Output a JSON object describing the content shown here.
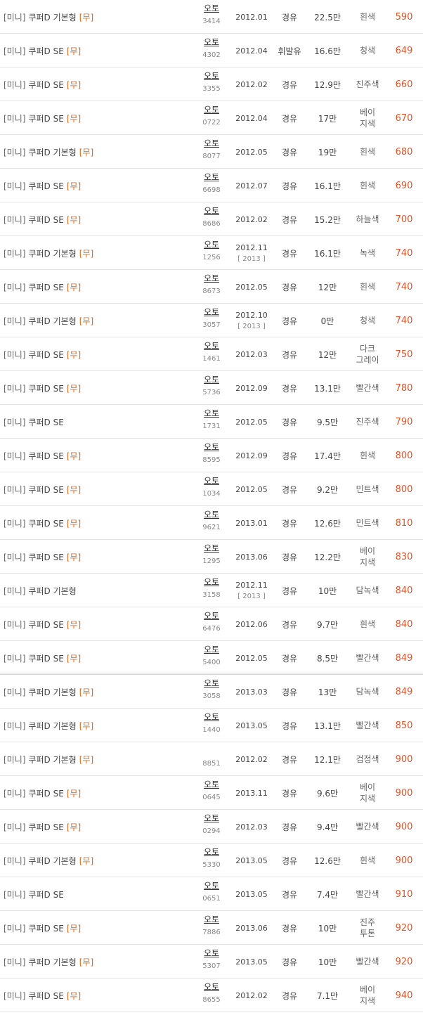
{
  "listings": [
    {
      "category": "[미니]",
      "model": "쿠퍼D 기본형",
      "tag": "[무]",
      "trans": "오토",
      "stock": "3414",
      "year": "2012.01",
      "year2": "",
      "fuel": "경유",
      "km": "22.5만",
      "color": "흰색",
      "price": "590"
    },
    {
      "category": "[미니]",
      "model": "쿠퍼D SE",
      "tag": "[무]",
      "trans": "오토",
      "stock": "4302",
      "year": "2012.04",
      "year2": "",
      "fuel": "휘발유",
      "km": "16.6만",
      "color": "청색",
      "price": "649"
    },
    {
      "category": "[미니]",
      "model": "쿠퍼D SE",
      "tag": "[무]",
      "trans": "오토",
      "stock": "3355",
      "year": "2012.02",
      "year2": "",
      "fuel": "경유",
      "km": "12.9만",
      "color": "진주색",
      "price": "660"
    },
    {
      "category": "[미니]",
      "model": "쿠퍼D SE",
      "tag": "[무]",
      "trans": "오토",
      "stock": "0722",
      "year": "2012.04",
      "year2": "",
      "fuel": "경유",
      "km": "17만",
      "color": "베이\n지색",
      "price": "670"
    },
    {
      "category": "[미니]",
      "model": "쿠퍼D 기본형",
      "tag": "[무]",
      "trans": "오토",
      "stock": "8077",
      "year": "2012.05",
      "year2": "",
      "fuel": "경유",
      "km": "19만",
      "color": "흰색",
      "price": "680"
    },
    {
      "category": "[미니]",
      "model": "쿠퍼D SE",
      "tag": "[무]",
      "trans": "오토",
      "stock": "6698",
      "year": "2012.07",
      "year2": "",
      "fuel": "경유",
      "km": "16.1만",
      "color": "흰색",
      "price": "690"
    },
    {
      "category": "[미니]",
      "model": "쿠퍼D SE",
      "tag": "[무]",
      "trans": "오토",
      "stock": "8686",
      "year": "2012.02",
      "year2": "",
      "fuel": "경유",
      "km": "15.2만",
      "color": "하늘색",
      "price": "700"
    },
    {
      "category": "[미니]",
      "model": "쿠퍼D 기본형",
      "tag": "[무]",
      "trans": "오토",
      "stock": "1256",
      "year": "2012.11",
      "year2": "[ 2013 ]",
      "fuel": "경유",
      "km": "16.1만",
      "color": "녹색",
      "price": "740"
    },
    {
      "category": "[미니]",
      "model": "쿠퍼D SE",
      "tag": "[무]",
      "trans": "오토",
      "stock": "8673",
      "year": "2012.05",
      "year2": "",
      "fuel": "경유",
      "km": "12만",
      "color": "흰색",
      "price": "740"
    },
    {
      "category": "[미니]",
      "model": "쿠퍼D 기본형",
      "tag": "[무]",
      "trans": "오토",
      "stock": "3057",
      "year": "2012.10",
      "year2": "[ 2013 ]",
      "fuel": "경유",
      "km": "0만",
      "color": "청색",
      "price": "740"
    },
    {
      "category": "[미니]",
      "model": "쿠퍼D SE",
      "tag": "[무]",
      "trans": "오토",
      "stock": "1461",
      "year": "2012.03",
      "year2": "",
      "fuel": "경유",
      "km": "12만",
      "color": "다크\n그레이",
      "price": "750"
    },
    {
      "category": "[미니]",
      "model": "쿠퍼D SE",
      "tag": "[무]",
      "trans": "오토",
      "stock": "5736",
      "year": "2012.09",
      "year2": "",
      "fuel": "경유",
      "km": "13.1만",
      "color": "빨간색",
      "price": "780"
    },
    {
      "category": "[미니]",
      "model": "쿠퍼D SE",
      "tag": "",
      "trans": "오토",
      "stock": "1731",
      "year": "2012.05",
      "year2": "",
      "fuel": "경유",
      "km": "9.5만",
      "color": "진주색",
      "price": "790"
    },
    {
      "category": "[미니]",
      "model": "쿠퍼D SE",
      "tag": "[무]",
      "trans": "오토",
      "stock": "8595",
      "year": "2012.09",
      "year2": "",
      "fuel": "경유",
      "km": "17.4만",
      "color": "흰색",
      "price": "800"
    },
    {
      "category": "[미니]",
      "model": "쿠퍼D SE",
      "tag": "[무]",
      "trans": "오토",
      "stock": "1034",
      "year": "2012.05",
      "year2": "",
      "fuel": "경유",
      "km": "9.2만",
      "color": "민트색",
      "price": "800"
    },
    {
      "category": "[미니]",
      "model": "쿠퍼D SE",
      "tag": "[무]",
      "trans": "오토",
      "stock": "9621",
      "year": "2013.01",
      "year2": "",
      "fuel": "경유",
      "km": "12.6만",
      "color": "민트색",
      "price": "810"
    },
    {
      "category": "[미니]",
      "model": "쿠퍼D SE",
      "tag": "[무]",
      "trans": "오토",
      "stock": "1295",
      "year": "2013.06",
      "year2": "",
      "fuel": "경유",
      "km": "12.2만",
      "color": "베이\n지색",
      "price": "830"
    },
    {
      "category": "[미니]",
      "model": "쿠퍼D 기본형",
      "tag": "",
      "trans": "오토",
      "stock": "3158",
      "year": "2012.11",
      "year2": "[ 2013 ]",
      "fuel": "경유",
      "km": "10만",
      "color": "담녹색",
      "price": "840"
    },
    {
      "category": "[미니]",
      "model": "쿠퍼D SE",
      "tag": "[무]",
      "trans": "오토",
      "stock": "6476",
      "year": "2012.06",
      "year2": "",
      "fuel": "경유",
      "km": "9.7만",
      "color": "흰색",
      "price": "840"
    },
    {
      "category": "[미니]",
      "model": "쿠퍼D SE",
      "tag": "[무]",
      "trans": "오토",
      "stock": "5400",
      "year": "2012.05",
      "year2": "",
      "fuel": "경유",
      "km": "8.5만",
      "color": "빨간색",
      "price": "849"
    },
    {
      "category": "[미니]",
      "model": "쿠퍼D 기본형",
      "tag": "[무]",
      "trans": "오토",
      "stock": "3058",
      "year": "2013.03",
      "year2": "",
      "fuel": "경유",
      "km": "13만",
      "color": "담녹색",
      "price": "849"
    },
    {
      "category": "[미니]",
      "model": "쿠퍼D 기본형",
      "tag": "[무]",
      "trans": "오토",
      "stock": "1440",
      "year": "2013.05",
      "year2": "",
      "fuel": "경유",
      "km": "13.1만",
      "color": "빨간색",
      "price": "850"
    },
    {
      "category": "[미니]",
      "model": "쿠퍼D 기본형",
      "tag": "[무]",
      "trans": "",
      "stock": "8851",
      "year": "2012.02",
      "year2": "",
      "fuel": "경유",
      "km": "12.1만",
      "color": "검정색",
      "price": "900"
    },
    {
      "category": "[미니]",
      "model": "쿠퍼D SE",
      "tag": "[무]",
      "trans": "오토",
      "stock": "0645",
      "year": "2013.11",
      "year2": "",
      "fuel": "경유",
      "km": "9.6만",
      "color": "베이\n지색",
      "price": "900"
    },
    {
      "category": "[미니]",
      "model": "쿠퍼D SE",
      "tag": "[무]",
      "trans": "오토",
      "stock": "0294",
      "year": "2012.03",
      "year2": "",
      "fuel": "경유",
      "km": "9.4만",
      "color": "빨간색",
      "price": "900"
    },
    {
      "category": "[미니]",
      "model": "쿠퍼D 기본형",
      "tag": "[무]",
      "trans": "오토",
      "stock": "5330",
      "year": "2013.05",
      "year2": "",
      "fuel": "경유",
      "km": "12.6만",
      "color": "흰색",
      "price": "900"
    },
    {
      "category": "[미니]",
      "model": "쿠퍼D SE",
      "tag": "",
      "trans": "오토",
      "stock": "0651",
      "year": "2013.05",
      "year2": "",
      "fuel": "경유",
      "km": "7.4만",
      "color": "빨간색",
      "price": "910"
    },
    {
      "category": "[미니]",
      "model": "쿠퍼D SE",
      "tag": "[무]",
      "trans": "오토",
      "stock": "7886",
      "year": "2013.06",
      "year2": "",
      "fuel": "경유",
      "km": "10만",
      "color": "진주\n투톤",
      "price": "920"
    },
    {
      "category": "[미니]",
      "model": "쿠퍼D 기본형",
      "tag": "[무]",
      "trans": "오토",
      "stock": "5307",
      "year": "2013.05",
      "year2": "",
      "fuel": "경유",
      "km": "10만",
      "color": "빨간색",
      "price": "920"
    },
    {
      "category": "[미니]",
      "model": "쿠퍼D SE",
      "tag": "[무]",
      "trans": "오토",
      "stock": "8655",
      "year": "2012.02",
      "year2": "",
      "fuel": "경유",
      "km": "7.1만",
      "color": "베이\n지색",
      "price": "940"
    }
  ]
}
